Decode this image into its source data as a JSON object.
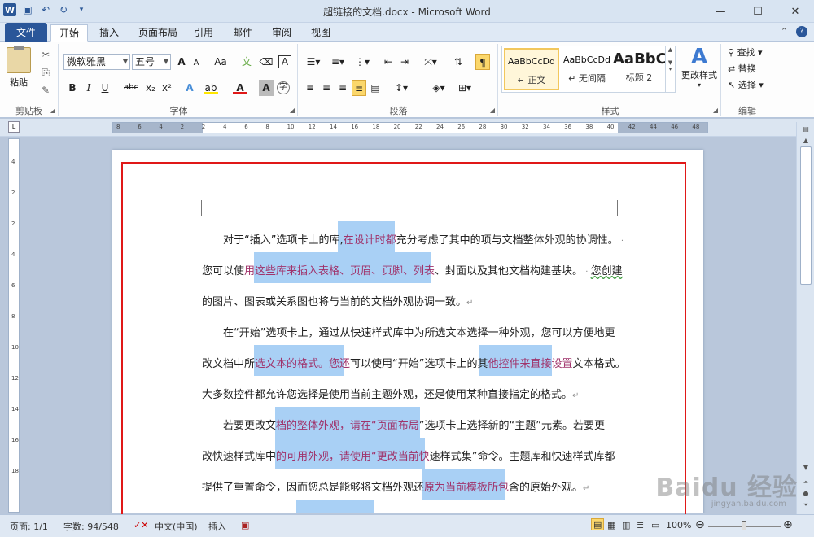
{
  "window": {
    "title": "超链接的文档.docx - Microsoft Word",
    "controls": {
      "minimize": "—",
      "maximize": "☐",
      "close": "✕"
    }
  },
  "tabs": [
    {
      "label": "文件"
    },
    {
      "label": "开始"
    },
    {
      "label": "插入"
    },
    {
      "label": "页面布局"
    },
    {
      "label": "引用"
    },
    {
      "label": "邮件"
    },
    {
      "label": "审阅"
    },
    {
      "label": "视图"
    }
  ],
  "ribbon": {
    "clipboard": {
      "paste_label": "粘贴",
      "group_label": "剪贴板"
    },
    "font": {
      "font_name": "微软雅黑",
      "font_size": "五号",
      "group_label": "字体",
      "bold": "B",
      "italic": "I",
      "underline": "U",
      "strike": "abc",
      "subscript": "x₂",
      "superscript": "x²",
      "grow": "A",
      "shrink": "A",
      "change_case": "Aa",
      "clear": "A"
    },
    "paragraph": {
      "group_label": "段落"
    },
    "styles": {
      "group_label": "样式",
      "items": [
        {
          "sample": "AaBbCcDd",
          "name": "↵ 正文"
        },
        {
          "sample": "AaBbCcDd",
          "name": "↵ 无间隔"
        },
        {
          "sample": "AaBbC",
          "name": "标题 2"
        }
      ],
      "change_styles": "更改样式"
    },
    "editing": {
      "group_label": "编辑",
      "find": "查找",
      "replace": "替换",
      "select": "选择"
    }
  },
  "ruler": {
    "labels": [
      "8",
      "6",
      "4",
      "2",
      "2",
      "4",
      "6",
      "8",
      "10",
      "12",
      "14",
      "16",
      "18",
      "20",
      "22",
      "24",
      "26",
      "28",
      "30",
      "32",
      "34",
      "36",
      "38",
      "40",
      "42",
      "44",
      "46",
      "48"
    ],
    "vlabels": [
      "4",
      "2",
      "2",
      "4",
      "6",
      "8",
      "10",
      "12",
      "14",
      "16",
      "18"
    ]
  },
  "document": {
    "p1": {
      "line1": {
        "a": "对于“插入”选项卡上的库,",
        "b": "在设计时都",
        "c": "充分考虑了其中的项与文档整体外观的协调性。"
      },
      "line2": {
        "a": "您可以使",
        "b": "用这些库来插入表格、页眉、页脚、列表",
        "c": "、封面以及其他文档构建基块。",
        "d": "您创建"
      },
      "line3": "的图片、图表或关系图也将与当前的文档外观协调一致。"
    },
    "p2": {
      "line1": "在“开始”选项卡上，通过从快速样式库中为所选文本选择一种外观，您可以方便地更",
      "line2": {
        "a": "改文档中所",
        "b": "选文本的格式。您还",
        "c": "可以使用“开始”选项卡上的其",
        "d": "他控件来直接设置",
        "e": "文本格式。"
      },
      "line3": "大多数控件都允许您选择是使用当前主题外观，还是使用某种直接指定的格式。"
    },
    "p3": {
      "line1": {
        "a": "若要更改文",
        "b": "档的整体外观，请在“页面布局",
        "c": "”选项卡上选择新的“主题”元素。若要更"
      },
      "line2": {
        "a": "改快速样式库中",
        "b": "的可用外观，请使用“更改当前快",
        "c": "速样式集”命令。主题库和快速样式库都"
      },
      "line3": {
        "a": "提供了重置命令，因而您总是能够将文档外观还",
        "b": "原为当前模板所包",
        "c": "含的原始外观。"
      }
    }
  },
  "statusbar": {
    "page": "页面: 1/1",
    "words": "字数: 94/548",
    "lang": "中文(中国)",
    "mode": "插入",
    "zoom": "100%"
  },
  "watermark": {
    "main": "Baidu 经验",
    "sub": "jingyan.baidu.com"
  },
  "colors": {
    "accent": "#2a5699",
    "highlight": "#a9d0f5",
    "link": "#a0336b",
    "annotation": "#e01818"
  }
}
